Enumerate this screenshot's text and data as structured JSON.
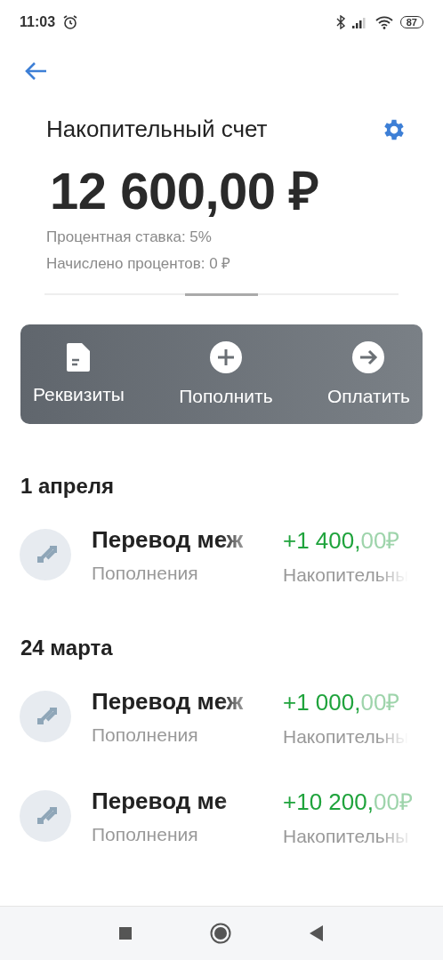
{
  "status_bar": {
    "time": "11:03",
    "battery": "87"
  },
  "account": {
    "title": "Накопительный счет",
    "balance": "12 600,00 ₽",
    "rate": "Процентная ставка: 5%",
    "accrued": "Начислено процентов: 0 ₽"
  },
  "actions": [
    {
      "kind": "document",
      "label": "Реквизиты"
    },
    {
      "kind": "plus",
      "label": "Пополнить"
    },
    {
      "kind": "arrow",
      "label": "Оплатить"
    }
  ],
  "groups": [
    {
      "date": "1 апреля",
      "transactions": [
        {
          "title": "Перевод меж",
          "amount_main": "+1 400,",
          "amount_faded": "00₽",
          "category": "Пополнения",
          "account": "Накопительны"
        }
      ]
    },
    {
      "date": "24 марта",
      "transactions": [
        {
          "title": "Перевод меж",
          "amount_main": "+1 000,",
          "amount_faded": "00₽",
          "category": "Пополнения",
          "account": "Накопительны"
        },
        {
          "title": "Перевод ме",
          "amount_main": "+10 200,",
          "amount_faded": "00₽",
          "category": "Пополнения",
          "account": "Накопительны"
        }
      ]
    }
  ]
}
